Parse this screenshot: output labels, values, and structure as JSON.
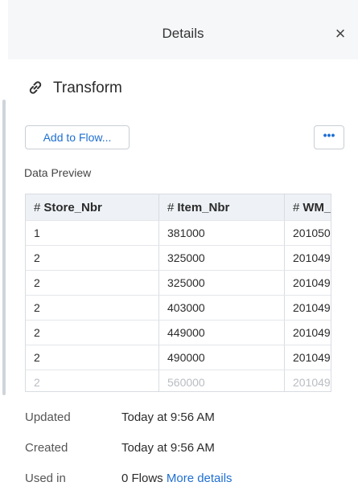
{
  "header": {
    "title": "Details"
  },
  "item": {
    "title": "Transform"
  },
  "actions": {
    "add_label": "Add to Flow...",
    "more_label": "•••"
  },
  "preview": {
    "label": "Data Preview",
    "columns": [
      {
        "type_icon": "#",
        "name": "Store_Nbr"
      },
      {
        "type_icon": "#",
        "name": "Item_Nbr"
      },
      {
        "type_icon": "#",
        "name": "WM_Week"
      }
    ],
    "rows": [
      [
        "1",
        "381000",
        "201050"
      ],
      [
        "2",
        "325000",
        "201049"
      ],
      [
        "2",
        "325000",
        "201049"
      ],
      [
        "2",
        "403000",
        "201049"
      ],
      [
        "2",
        "449000",
        "201049"
      ],
      [
        "2",
        "490000",
        "201049"
      ],
      [
        "2",
        "560000",
        "201049"
      ]
    ]
  },
  "meta": {
    "updated_label": "Updated",
    "updated_value": "Today at 9:56 AM",
    "created_label": "Created",
    "created_value": "Today at 9:56 AM",
    "used_label": "Used in",
    "used_value": "0 Flows",
    "more_details": "More details"
  },
  "colors": {
    "link": "#1f6fd1",
    "header_bg": "#f6f7f9",
    "table_header_bg": "#eef2f6"
  }
}
